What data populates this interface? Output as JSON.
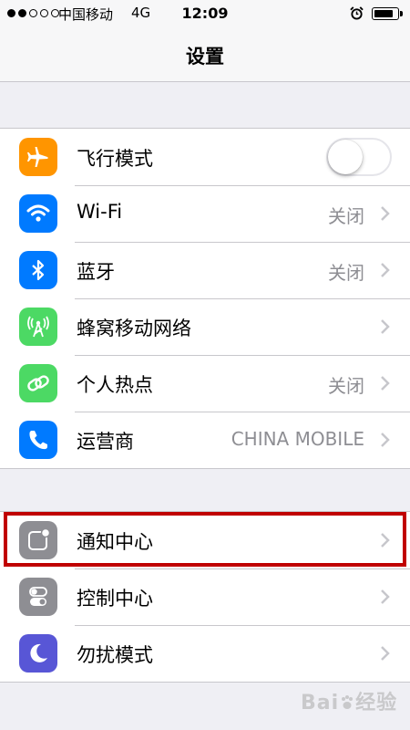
{
  "status_bar": {
    "carrier": "中国移动",
    "network": "4G",
    "time": "12:09",
    "battery_level": 0.85
  },
  "nav": {
    "title": "设置"
  },
  "groups": [
    {
      "rows": [
        {
          "label": "飞行模式",
          "value": "",
          "icon": "airplane-icon",
          "color": "#ff9500",
          "toggle": false
        },
        {
          "label": "Wi-Fi",
          "value": "关闭",
          "icon": "wifi-icon",
          "color": "#007aff"
        },
        {
          "label": "蓝牙",
          "value": "关闭",
          "icon": "bluetooth-icon",
          "color": "#007aff"
        },
        {
          "label": "蜂窝移动网络",
          "value": "",
          "icon": "cellular-icon",
          "color": "#4cd964"
        },
        {
          "label": "个人热点",
          "value": "关闭",
          "icon": "hotspot-icon",
          "color": "#4cd964"
        },
        {
          "label": "运营商",
          "value": "CHINA MOBILE",
          "icon": "phone-icon",
          "color": "#007aff"
        }
      ]
    },
    {
      "rows": [
        {
          "label": "通知中心",
          "value": "",
          "icon": "notification-icon",
          "color": "#8e8e93"
        },
        {
          "label": "控制中心",
          "value": "",
          "icon": "control-center-icon",
          "color": "#8e8e93"
        },
        {
          "label": "勿扰模式",
          "value": "",
          "icon": "moon-icon",
          "color": "#5856d6"
        }
      ]
    }
  ],
  "watermark": {
    "brand_a": "Bai",
    "brand_b": "经验"
  }
}
